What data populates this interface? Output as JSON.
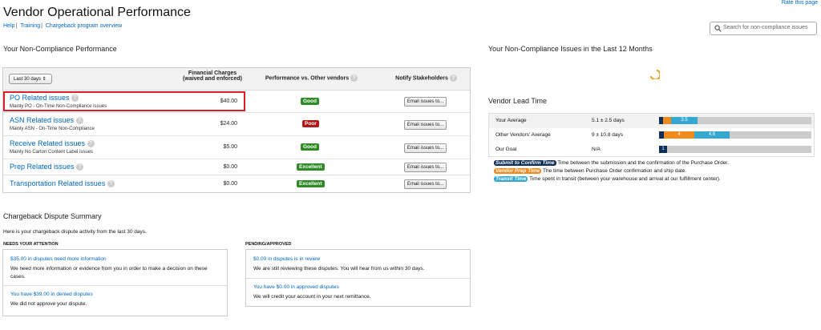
{
  "header": {
    "rate_link": "Rate this page",
    "title": "Vendor Operational Performance",
    "links": [
      "Help",
      "Training",
      "Chargeback program overview"
    ],
    "search_placeholder": "Search for non-compliance issues"
  },
  "performance": {
    "section_title": "Your Non-Compliance Performance",
    "period_select": "Last 30 days",
    "columns": {
      "charges": "Financial Charges",
      "charges_sub": "(waived and enforced)",
      "perf": "Performance vs. Other vendors",
      "notify": "Notify Stakeholders"
    },
    "help_glyph": "?",
    "rows": [
      {
        "name": "PO Related issues",
        "sub": "Mainly PO - On-Time Non-Compliance issues",
        "amount": "$40.00",
        "rating": "Good",
        "email": "Email issues to..."
      },
      {
        "name": "ASN Related issues",
        "sub": "Mainly ASN - On-Time Non-Compliance",
        "amount": "$24.00",
        "rating": "Poor",
        "email": "Email issues to..."
      },
      {
        "name": "Receive Related issues",
        "sub": "Mainly No Carton Content Label issues",
        "amount": "$5.00",
        "rating": "Good",
        "email": "Email issues to..."
      },
      {
        "name": "Prep Related issues",
        "sub": "",
        "amount": "$0.00",
        "rating": "Excellent",
        "email": "Email issues to..."
      },
      {
        "name": "Transportation Related issues",
        "sub": "",
        "amount": "$0.00",
        "rating": "Excellent",
        "email": "Email issues to..."
      }
    ]
  },
  "last12": {
    "title": "Your Non-Compliance Issues in the Last 12 Months"
  },
  "lead_time": {
    "title": "Vendor Lead Time",
    "rows": [
      {
        "label": "Your Average",
        "value": "5.1 ± 2.5 days",
        "segments": [
          {
            "color": "#0e2f5a",
            "value": 0.5,
            "label": ""
          },
          {
            "color": "#f08a1d",
            "value": 1.0,
            "label": ""
          },
          {
            "color": "#35a8d1",
            "value": 3.5,
            "label": "3.5"
          }
        ]
      },
      {
        "label": "Other Vendors' Average",
        "value": "9 ± 10.8 days",
        "segments": [
          {
            "color": "#0e2f5a",
            "value": 0.6,
            "label": ""
          },
          {
            "color": "#f08a1d",
            "value": 4,
            "label": "4"
          },
          {
            "color": "#35a8d1",
            "value": 4.6,
            "label": "4.6"
          }
        ]
      },
      {
        "label": "Our Goal",
        "value": "N/A",
        "segments": [
          {
            "color": "#0e2f5a",
            "value": 1,
            "label": "1"
          }
        ]
      }
    ],
    "legend": [
      {
        "tag": "Submit to Confirm Time",
        "color": "#0e2f5a",
        "text": "Time between the submission and the confirmation of the Purchase Order."
      },
      {
        "tag": "Vendor Prep Time",
        "color": "#f08a1d",
        "text": "The time between Purchase Order confirmation and ship date."
      },
      {
        "tag": "Transit Time",
        "color": "#35a8d1",
        "text": "Time spent in transit (between your warehouse and arrival at our fulfillment center)."
      }
    ]
  },
  "disputes": {
    "title": "Chargeback Dispute Summary",
    "intro": "Here is your chargeback dispute activity from the last 30 days.",
    "attention": {
      "heading": "NEEDS YOUR ATTENTION",
      "items": [
        {
          "link": "$35.00 in disputes need more information",
          "text": "We need more information or evidence from you in order to make a decision on these cases."
        },
        {
          "link": "You have $39.00 in denied disputes",
          "text": "We did not approve your dispute."
        }
      ]
    },
    "pending": {
      "heading": "PENDING/APPROVED",
      "items": [
        {
          "link": "$0.00 in disputes is in review",
          "text": "We are still reviewing these disputes. You will hear from us within 30 days."
        },
        {
          "link": "You have $0.00 in approved disputes",
          "text": "We will credit your account in your next remittance."
        }
      ]
    }
  }
}
